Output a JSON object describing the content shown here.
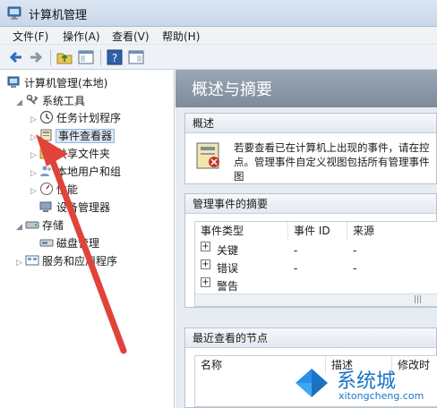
{
  "window": {
    "title": "计算机管理"
  },
  "menu": [
    "文件(F)",
    "操作(A)",
    "查看(V)",
    "帮助(H)"
  ],
  "tree": {
    "root": "计算机管理(本地)",
    "system_tools": "系统工具",
    "task_scheduler": "任务计划程序",
    "event_viewer": "事件查看器",
    "shared_folders": "共享文件夹",
    "local_users": "本地用户和组",
    "performance": "性能",
    "device_manager": "设备管理器",
    "storage": "存储",
    "disk_management": "磁盘管理",
    "services_apps": "服务和应用程序"
  },
  "right": {
    "header": "概述与摘要",
    "overview_title": "概述",
    "overview_text": "若要查看已在计算机上出现的事件，请在控点。管理事件自定义视图包括所有管理事件图",
    "summary_title": "管理事件的摘要",
    "columns": [
      "事件类型",
      "事件 ID",
      "来源"
    ],
    "rows": [
      {
        "type": "关键",
        "id": "-",
        "source": "-"
      },
      {
        "type": "错误",
        "id": "-",
        "source": "-"
      },
      {
        "type": "警告",
        "id": "",
        "source": ""
      }
    ],
    "recent_title": "最近查看的节点",
    "recent_columns": [
      "名称",
      "描述",
      "修改时"
    ]
  },
  "watermark": {
    "brand": "系统城",
    "url": "xitongcheng.com"
  },
  "colors": {
    "arrow": "#e0433a",
    "accent": "#1a73c8"
  }
}
